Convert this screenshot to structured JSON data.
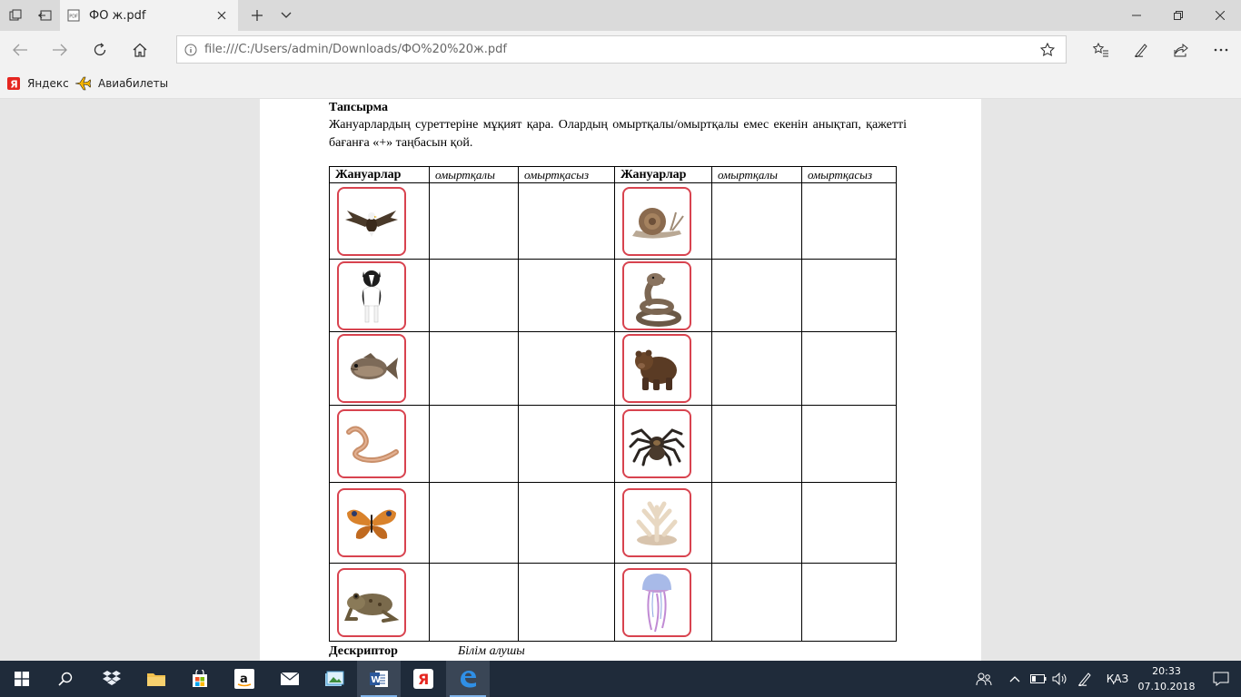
{
  "browser": {
    "tab_title": "ФО ж.pdf",
    "address": "file:///C:/Users/admin/Downloads/ФО%20%20ж.pdf",
    "favorites": [
      {
        "label": "Яндекс",
        "icon": "yandex-icon"
      },
      {
        "label": "Авиабилеты",
        "icon": "plane-icon"
      }
    ]
  },
  "document": {
    "task_title": "Тапсырма",
    "task_text": "Жануарлардың суреттеріне мұқият қара. Олардың омыртқалы/омыртқалы емес екенін анықтап, қажетті бағанға «+» таңбасын қой.",
    "table": {
      "headers": [
        "Жануарлар",
        "омыртқалы",
        "омыртқасыз",
        "Жануарлар",
        "омыртқалы",
        "омыртқасыз"
      ],
      "rows": [
        {
          "left": "eagle-icon",
          "right": "snail-icon"
        },
        {
          "left": "dog-icon",
          "right": "cobra-icon"
        },
        {
          "left": "fish-icon",
          "right": "bear-icon"
        },
        {
          "left": "worm-icon",
          "right": "spider-icon"
        },
        {
          "left": "butterfly-icon",
          "right": "coral-icon"
        },
        {
          "left": "frog-icon",
          "right": "jellyfish-icon"
        }
      ]
    },
    "descriptor_label": "Дескриптор",
    "descriptor_value": "Білім алушы"
  },
  "taskbar": {
    "language": "ҚАЗ",
    "time": "20:33",
    "date": "07.10.2018"
  },
  "colors": {
    "card_border": "#d8434f",
    "taskbar_bg": "#1f2b3a",
    "accent": "#0078d7"
  }
}
